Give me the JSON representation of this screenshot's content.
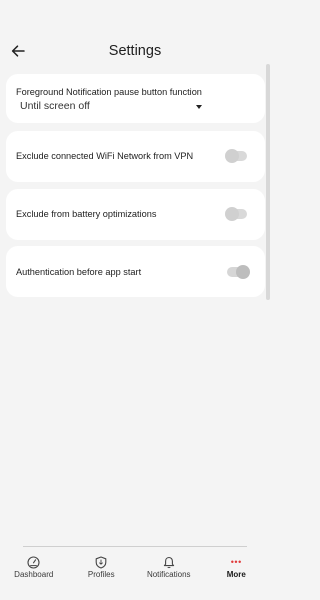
{
  "header": {
    "title": "Settings"
  },
  "cards": [
    {
      "label": "Foreground Notification pause button function",
      "dropdown_value": "Until screen off"
    },
    {
      "label": "Exclude connected WiFi Network from VPN",
      "toggle": "off"
    },
    {
      "label": "Exclude from battery optimizations",
      "toggle": "off"
    },
    {
      "label": "Authentication before app start",
      "toggle": "on"
    }
  ],
  "nav": {
    "items": [
      {
        "label": "Dashboard",
        "icon": "dashboard-icon"
      },
      {
        "label": "Profiles",
        "icon": "shield-icon"
      },
      {
        "label": "Notifications",
        "icon": "bell-icon"
      },
      {
        "label": "More",
        "icon": "more-dots-icon",
        "active": true
      }
    ]
  },
  "colors": {
    "background": "#f4f4f4",
    "card": "#ffffff",
    "accent": "#e03a3a"
  }
}
